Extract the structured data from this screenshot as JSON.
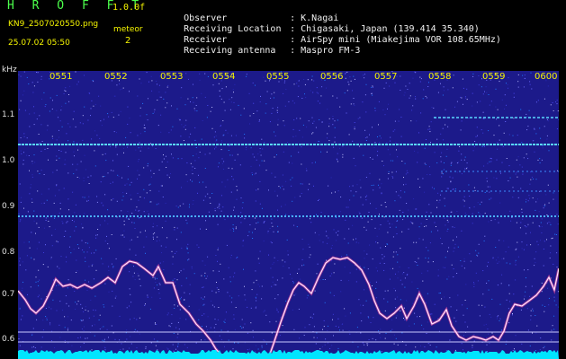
{
  "app": {
    "title": "H R O F F T",
    "version": "1.0.0f",
    "filename": "KN9_2507020550.png",
    "datetime": "25.07.02 05:50",
    "meteor_label": "meteor",
    "meteor_count": "2"
  },
  "info": [
    {
      "label": "Observer",
      "value": ": K.Nagai"
    },
    {
      "label": "Receiving Location",
      "value": ": Chigasaki, Japan (139.414 35.340)"
    },
    {
      "label": "Receiver",
      "value": ": AirSpy mini (Miakejima VOR 108.65MHz)"
    },
    {
      "label": "Receiving antenna",
      "value": ": Maspro FM-3"
    }
  ],
  "spectrogram": {
    "y_unit": "kHz",
    "y_ticks": [
      "1.1",
      "1.0",
      "0.9",
      "0.8",
      "0.7",
      "0.6"
    ],
    "time_ticks": [
      "0551",
      "0552",
      "0553",
      "0554",
      "0555",
      "0556",
      "0557",
      "0558",
      "0559",
      "0600"
    ]
  },
  "colors": {
    "background": "#000000",
    "spectrogram_bg": "#1c1a8a",
    "axis_text": "#f5f500",
    "trace": "#ffd0ff",
    "noise_floor": "#00e5ff"
  }
}
